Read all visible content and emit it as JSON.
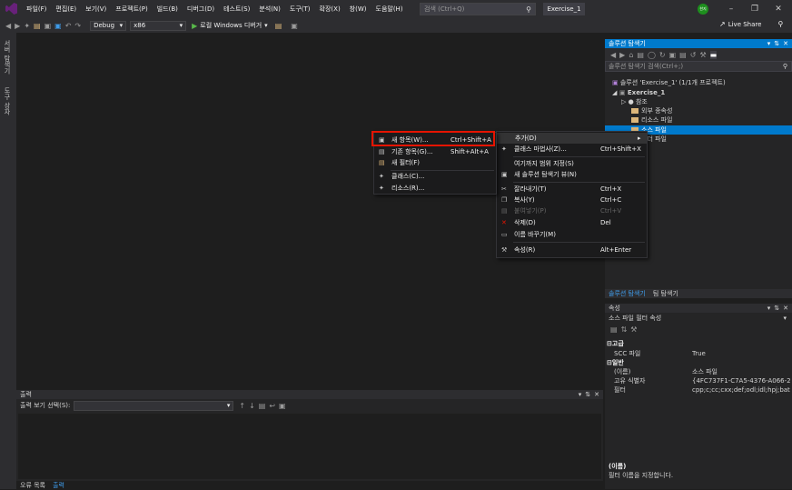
{
  "menubar": [
    "파일(F)",
    "편집(E)",
    "보기(V)",
    "프로젝트(P)",
    "빌드(B)",
    "디버그(D)",
    "테스트(S)",
    "분석(N)",
    "도구(T)",
    "확장(X)",
    "창(W)",
    "도움말(H)"
  ],
  "search": {
    "placeholder": "검색 (Ctrl+Q)"
  },
  "solution_title": "Exercise_1",
  "avatar_text": "한지",
  "toolbar": {
    "config": "Debug",
    "platform": "x86",
    "run_label": "로컬 Windows 디버거"
  },
  "live_share": "Live Share",
  "left_tabs": [
    "서버 탐색기",
    "도구 상자"
  ],
  "solution_explorer": {
    "title": "솔루션 탐색기",
    "search_placeholder": "솔루션 탐색기 검색(Ctrl+;)",
    "tree": [
      "솔루션 'Exercise_1' (1/1개 프로젝트)",
      "Exercise_1",
      "참조",
      "외부 종속성",
      "리소스 파일",
      "소스 파일",
      "헤더 파일"
    ],
    "tabs": [
      "솔루션 탐색기",
      "팀 탐색기"
    ]
  },
  "properties": {
    "title": "속성",
    "object": "소스 파일  필터 속성",
    "cat_advanced": "고급",
    "cat_general": "일반",
    "rows": [
      {
        "name": "SCC 파일",
        "value": "True"
      },
      {
        "name": "(이름)",
        "value": "소스 파일"
      },
      {
        "name": "고유 식별자",
        "value": "{4FC737F1-C7A5-4376-A066-2A32"
      },
      {
        "name": "필터",
        "value": "cpp;c;cc;cxx;def;odl;idl;hpj;bat;asm;"
      }
    ],
    "desc_title": "(이름)",
    "desc_text": "필터 이름을 지정합니다."
  },
  "output": {
    "title": "출력",
    "source_label": "출력 보기 선택(S):"
  },
  "bottom_tabs": [
    "오류 목록",
    "출력"
  ],
  "context_menu": {
    "items": [
      {
        "label": "추가(D)",
        "shortcut": "",
        "icon": "add-icon",
        "disabled": false
      },
      {
        "label": "클래스 마법사(Z)...",
        "shortcut": "Ctrl+Shift+X",
        "icon": "class-wizard-icon",
        "disabled": false
      },
      {
        "label": "여기까지 범위 지정(S)",
        "shortcut": "",
        "icon": "",
        "disabled": false
      },
      {
        "label": "새 솔루션 탐색기 뷰(N)",
        "shortcut": "",
        "icon": "new-view-icon",
        "disabled": false
      },
      {
        "label": "잘라내기(T)",
        "shortcut": "Ctrl+X",
        "icon": "cut-icon",
        "disabled": false
      },
      {
        "label": "복사(Y)",
        "shortcut": "Ctrl+C",
        "icon": "copy-icon",
        "disabled": false
      },
      {
        "label": "붙여넣기(P)",
        "shortcut": "Ctrl+V",
        "icon": "paste-icon",
        "disabled": true
      },
      {
        "label": "삭제(D)",
        "shortcut": "Del",
        "icon": "delete-icon",
        "disabled": false
      },
      {
        "label": "이름 바꾸기(M)",
        "shortcut": "",
        "icon": "rename-icon",
        "disabled": false
      },
      {
        "label": "속성(R)",
        "shortcut": "Alt+Enter",
        "icon": "wrench-icon",
        "disabled": false
      }
    ]
  },
  "submenu": {
    "items": [
      {
        "label": "새 항목(W)...",
        "shortcut": "Ctrl+Shift+A"
      },
      {
        "label": "기존 항목(G)...",
        "shortcut": "Shift+Alt+A"
      },
      {
        "label": "새 필터(F)",
        "shortcut": ""
      },
      {
        "label": "클래스(C)...",
        "shortcut": ""
      },
      {
        "label": "리소스(R)...",
        "shortcut": ""
      }
    ]
  },
  "colors": {
    "accent": "#007acc",
    "highlight_box": "#e51400",
    "vs_purple": "#68217a"
  }
}
